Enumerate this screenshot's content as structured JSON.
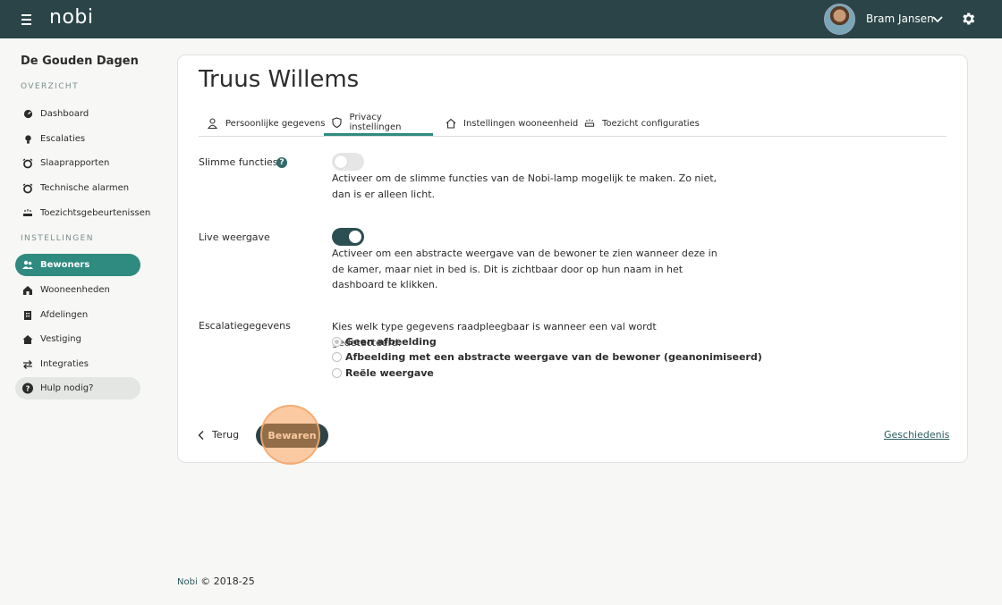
{
  "header": {
    "logo": "nobi",
    "user_name": "Bram Jansen",
    "menu_icon": "hamburger-icon",
    "settings_icon": "gear-icon"
  },
  "sidebar": {
    "org_name": "De Gouden Dagen",
    "overview_title": "OVERZICHT",
    "overview_items": [
      {
        "label": "Dashboard",
        "icon": "dashboard-icon"
      },
      {
        "label": "Escalaties",
        "icon": "bulb-icon"
      },
      {
        "label": "Slaaprapporten",
        "icon": "alarm-clock-icon"
      },
      {
        "label": "Technische alarmen",
        "icon": "alarm-clock-icon"
      },
      {
        "label": "Toezichtsgebeurtenissen",
        "icon": "bed-alarm-icon"
      }
    ],
    "settings_title": "INSTELLINGEN",
    "settings_items": [
      {
        "label": "Bewoners",
        "icon": "people-icon",
        "active": true
      },
      {
        "label": "Wooneenheden",
        "icon": "home-icon"
      },
      {
        "label": "Afdelingen",
        "icon": "building-icon"
      },
      {
        "label": "Vestiging",
        "icon": "house-icon"
      },
      {
        "label": "Integraties",
        "icon": "swap-icon"
      }
    ],
    "help_label": "Hulp nodig?"
  },
  "main": {
    "title": "Truus Willems",
    "tabs": [
      {
        "label": "Persoonlijke gegevens",
        "icon": "person-icon"
      },
      {
        "label": "Privacy instellingen",
        "icon": "shield-icon",
        "active": true
      },
      {
        "label": "Instellingen wooneenheid",
        "icon": "home-icon"
      },
      {
        "label": "Toezicht configuraties",
        "icon": "bed-alarm-icon"
      }
    ],
    "smart_functions": {
      "label": "Slimme functies",
      "enabled": false,
      "description": "Activeer om de slimme functies van de Nobi-lamp mogelijk te maken. Zo niet, dan is er alleen licht."
    },
    "live_view": {
      "label": "Live weergave",
      "enabled": true,
      "description": "Activeer om een abstracte weergave van de bewoner te zien wanneer deze in de kamer, maar niet in bed is. Dit is zichtbaar door op hun naam in het dashboard te klikken."
    },
    "escalation_data": {
      "label": "Escalatiegegevens",
      "description": "Kies welk type gegevens raadpleegbaar is wanneer een val wordt gedetecteerd.",
      "options": [
        "Geen afbeelding",
        "Afbeelding met een abstracte weergave van de bewoner (geanonimiseerd)",
        "Reële weergave"
      ],
      "selected": "Geen afbeelding"
    },
    "back_label": "Terug",
    "save_label": "Bewaren",
    "history_label": "Geschiedenis"
  },
  "footer": {
    "brand": "Nobi",
    "copyright": "© 2018-25"
  },
  "colors": {
    "topbar": "#2b4448",
    "accent": "#2f8a80",
    "toggle_on": "#2b4f52"
  }
}
